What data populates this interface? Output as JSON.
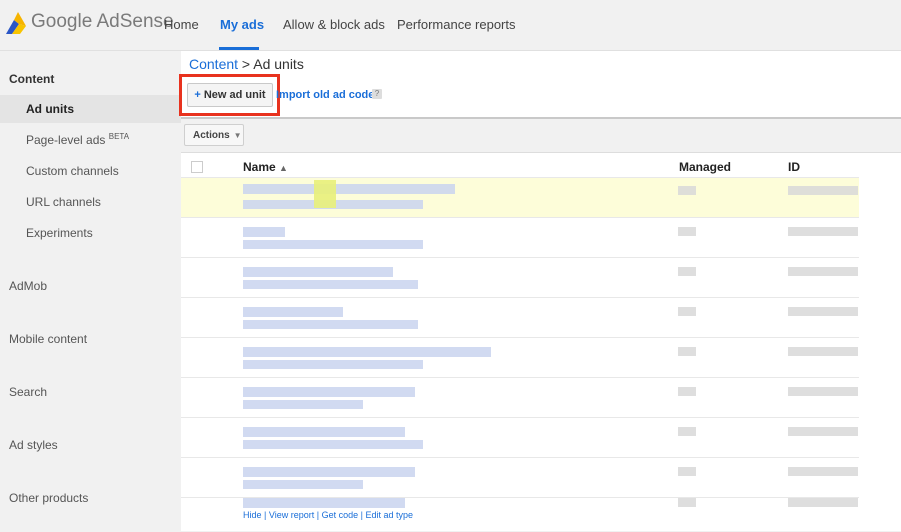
{
  "app": {
    "logo_text": "Google AdSense"
  },
  "nav": {
    "home": "Home",
    "my_ads": "My ads",
    "allow_block": "Allow & block ads",
    "performance": "Performance reports"
  },
  "sidebar": {
    "content_header": "Content",
    "ad_units": "Ad units",
    "page_level_ads": "Page-level ads",
    "beta": "BETA",
    "custom_channels": "Custom channels",
    "url_channels": "URL channels",
    "experiments": "Experiments",
    "admob": "AdMob",
    "mobile_content": "Mobile content",
    "search": "Search",
    "ad_styles": "Ad styles",
    "other_products": "Other products"
  },
  "breadcrumb": {
    "parent": "Content",
    "sep": " > ",
    "current": "Ad units"
  },
  "toolbar": {
    "new_ad_unit": "New ad unit",
    "import_old": "Import old ad code",
    "help": "?",
    "actions": "Actions"
  },
  "table": {
    "columns": {
      "name": "Name",
      "managed": "Managed",
      "id": "ID"
    },
    "sort_icon": "sort-up-icon"
  },
  "footer_links": [
    "Hide",
    "View report",
    "Get code",
    "Edit ad type"
  ],
  "colors": {
    "accent": "#1a6ed8",
    "highlight_box": "#e8321e",
    "selected_row": "#fdfdd9"
  }
}
